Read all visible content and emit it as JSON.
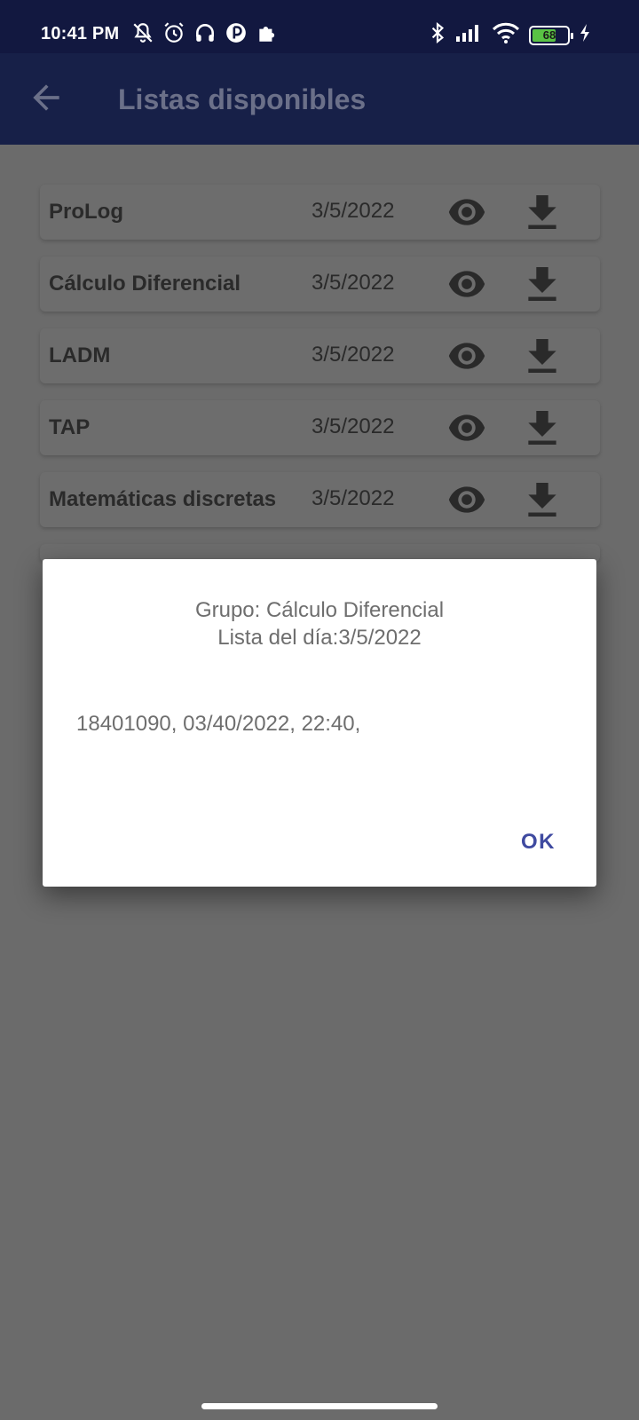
{
  "status_bar": {
    "time": "10:41 PM",
    "battery_level": "68",
    "battery_fill_percent": 68,
    "icons_left": [
      "muted-bell-icon",
      "alarm-icon",
      "headset-icon",
      "app-icon",
      "puzzle-icon"
    ],
    "icons_right": [
      "bluetooth-icon",
      "signal-icon",
      "wifi-icon",
      "battery-icon",
      "charging-icon"
    ]
  },
  "app_bar": {
    "title": "Listas disponibles",
    "back_icon": "arrow-back-icon"
  },
  "lists": [
    {
      "name": "ProLog",
      "date": "3/5/2022"
    },
    {
      "name": "Cálculo Diferencial",
      "date": "3/5/2022"
    },
    {
      "name": "LADM",
      "date": "3/5/2022"
    },
    {
      "name": "TAP",
      "date": "3/5/2022"
    },
    {
      "name": "Matemáticas discretas",
      "date": "3/5/2022"
    }
  ],
  "dialog": {
    "title_line1": "Grupo: Cálculo Diferencial",
    "title_line2": "Lista del día:3/5/2022",
    "message": "18401090, 03/40/2022, 22:40,",
    "ok_label": "OK"
  },
  "colors": {
    "status_bar": "#121840",
    "app_bar": "#172048",
    "scrim_background": "#6b6b6b",
    "accent": "#3f4aa0",
    "battery": "#59c244"
  }
}
